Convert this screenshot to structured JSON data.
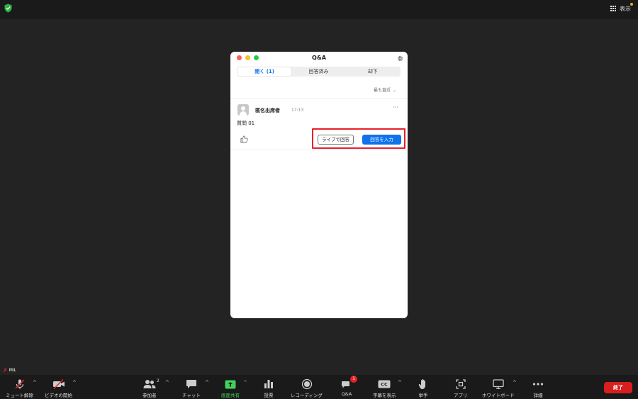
{
  "topbar": {
    "view_label": "表示"
  },
  "qa": {
    "title": "Q&A",
    "tabs": [
      {
        "label": "開く (1)",
        "active": true
      },
      {
        "label": "回答済み",
        "active": false
      },
      {
        "label": "却下",
        "active": false
      }
    ],
    "sort_label": "最も直近",
    "question": {
      "name": "匿名出席者",
      "time": "17:13",
      "text": "質問 01",
      "more": "···",
      "live_answer_label": "ライブで回答",
      "type_answer_label": "回答を入力"
    }
  },
  "mic_indicator": {
    "label": "MIL"
  },
  "toolbar": {
    "items": [
      {
        "label": "ミュート解除",
        "icon": "mic-off-icon"
      },
      {
        "label": "ビデオの開始",
        "icon": "video-off-icon"
      },
      {
        "label": "参加者",
        "icon": "participants-icon",
        "count": "2"
      },
      {
        "label": "チャット",
        "icon": "chat-icon"
      },
      {
        "label": "画面共有",
        "icon": "share-screen-icon"
      },
      {
        "label": "投票",
        "icon": "polling-icon"
      },
      {
        "label": "レコーディング",
        "icon": "record-icon"
      },
      {
        "label": "Q&A",
        "icon": "qa-icon",
        "badge": "1"
      },
      {
        "label": "字幕を表示",
        "icon": "cc-icon",
        "cc_text": "CC"
      },
      {
        "label": "挙手",
        "icon": "raise-hand-icon"
      },
      {
        "label": "アプリ",
        "icon": "apps-icon"
      },
      {
        "label": "ホワイトボード",
        "icon": "whiteboard-icon"
      },
      {
        "label": "詳細",
        "icon": "more-icon"
      }
    ],
    "end_label": "終了"
  },
  "colors": {
    "accent_blue": "#0e72ed",
    "highlight_red": "#e8202a",
    "share_green": "#3ed45b",
    "end_red": "#d71f1f"
  }
}
